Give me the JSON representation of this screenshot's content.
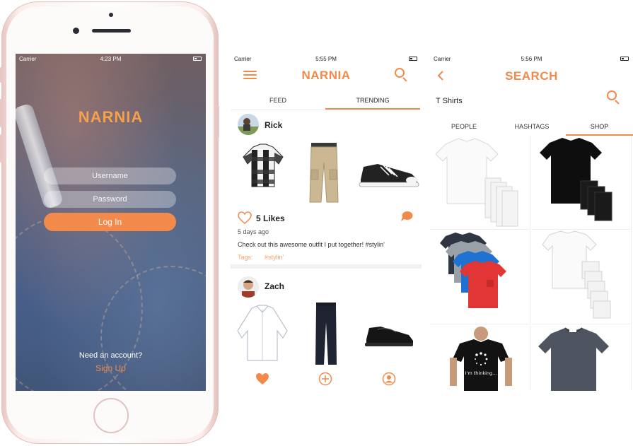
{
  "login": {
    "status": {
      "carrier": "Carrier",
      "time": "4:23 PM"
    },
    "title": "NARNIA",
    "username_placeholder": "Username",
    "password_placeholder": "Password",
    "login_button": "Log In",
    "need_account": "Need an account?",
    "signup": "Sign Up"
  },
  "feed": {
    "status": {
      "carrier": "Carrier",
      "time": "5:55 PM"
    },
    "title": "NARNIA",
    "tabs": [
      "FEED",
      "TRENDING"
    ],
    "active_tab": "TRENDING",
    "posts": [
      {
        "user": "Rick",
        "items": [
          "plaid-shirt",
          "khaki-pants",
          "black-sneakers"
        ],
        "likes": "5 Likes",
        "ago": "5 days ago",
        "caption": "Check out this awesome outfit I put together! #stylin'",
        "tags_label": "Tags:",
        "tags": "#stylin'"
      },
      {
        "user": "Zach",
        "items": [
          "white-dress-shirt",
          "black-pants",
          "black-loafers"
        ]
      }
    ],
    "accent_color": "#f28a4c"
  },
  "search": {
    "status": {
      "carrier": "Carrier",
      "time": "5:56 PM"
    },
    "title": "SEARCH",
    "query": "T Shirts",
    "tabs": [
      "PEOPLE",
      "HASHTAGS",
      "SHOP"
    ],
    "active_tab": "SHOP",
    "results": [
      {
        "item": "white-tshirt-pack",
        "color": "#ffffff"
      },
      {
        "item": "black-tshirt-pack",
        "color": "#111111"
      },
      {
        "item": "multicolor-tshirt-pack",
        "color": "#e63a3a"
      },
      {
        "item": "white-tshirt-stack",
        "color": "#ffffff"
      },
      {
        "item": "im-thinking-tshirt",
        "print": "I'm thinking..."
      },
      {
        "item": "gray-tshirt",
        "color": "#4f5560"
      }
    ]
  }
}
